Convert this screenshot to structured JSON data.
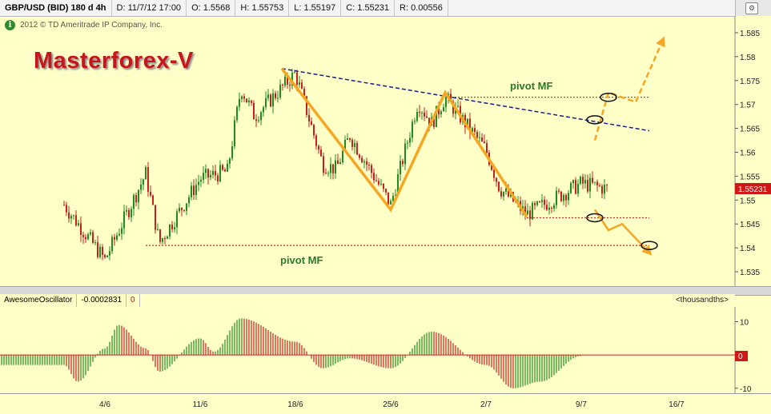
{
  "header": {
    "symbol": "GBP/USD (BID) 180 d 4h",
    "date": "D: 11/7/12 17:00",
    "open": "O: 1.5568",
    "high": "H: 1.55753",
    "low": "L: 1.55197",
    "close": "C: 1.55231",
    "range": "R: 0.00556"
  },
  "copyright": "2012 © TD Ameritrade IP Company, Inc.",
  "brand": "Masterforex-V",
  "price_badge": "1.55231",
  "annotations": {
    "pivot_upper": "pivot MF",
    "pivot_lower": "pivot MF"
  },
  "indicator": {
    "name": "AwesomeOscillator",
    "value": "-0.0002831",
    "zero": "0",
    "unit": "<thousandths>"
  },
  "osc_badge": "0",
  "colors": {
    "background": "#ffffc8",
    "up": "#1e8c1e",
    "down": "#c81e1e",
    "trend": "#f5a623",
    "trendline": "#1a1a8c",
    "pivot": "#cc2222",
    "brand": "#c8151b"
  },
  "chart_data": [
    {
      "type": "candlestick",
      "title": "GBP/USD (BID) 180 d 4h",
      "ylim": [
        1.5335,
        1.587
      ],
      "y_ticks": [
        "1.535",
        "1.54",
        "1.545",
        "1.55",
        "1.555",
        "1.56",
        "1.565",
        "1.57",
        "1.575",
        "1.58",
        "1.585"
      ],
      "x_tick_labels": [
        "4/6",
        "11/6",
        "18/6",
        "25/6",
        "2/7",
        "9/7",
        "16/7"
      ],
      "swing_points": [
        {
          "x": "1/6",
          "y": 1.549
        },
        {
          "x": "4/6",
          "y": 1.5375
        },
        {
          "x": "7/6",
          "y": 1.5555
        },
        {
          "x": "8/6",
          "y": 1.541
        },
        {
          "x": "11/6",
          "y": 1.5545
        },
        {
          "x": "13/6",
          "y": 1.556
        },
        {
          "x": "14/6",
          "y": 1.5735
        },
        {
          "x": "15/6",
          "y": 1.5675
        },
        {
          "x": "18/6",
          "y": 1.5765
        },
        {
          "x": "20/6",
          "y": 1.5575
        },
        {
          "x": "21/6",
          "y": 1.5565
        },
        {
          "x": "22/6",
          "y": 1.5635
        },
        {
          "x": "25/6",
          "y": 1.549
        },
        {
          "x": "27/6",
          "y": 1.5705
        },
        {
          "x": "28/6",
          "y": 1.566
        },
        {
          "x": "29/6",
          "y": 1.5715
        },
        {
          "x": "2/7",
          "y": 1.5605
        },
        {
          "x": "3/7",
          "y": 1.5525
        },
        {
          "x": "5/7",
          "y": 1.547
        },
        {
          "x": "9/7",
          "y": 1.5535
        },
        {
          "x": "11/7",
          "y": 1.55231
        }
      ],
      "trend_path": [
        {
          "x": "17/6",
          "y": 1.5775
        },
        {
          "x": "25/6",
          "y": 1.548
        },
        {
          "x": "29/6",
          "y": 1.5725
        },
        {
          "x": "5/7",
          "y": 1.5465
        }
      ],
      "trendline": [
        {
          "x": "17/6",
          "y": 1.5775
        },
        {
          "x": "14/7",
          "y": 1.5645
        }
      ],
      "pivots": [
        {
          "label": "pivot MF",
          "y": 1.5715,
          "from": "29/6",
          "to": "14/7"
        },
        {
          "label": "",
          "y": 1.5463,
          "from": "5/7",
          "to": "14/7"
        },
        {
          "label": "pivot MF",
          "y": 1.5405,
          "from": "7/6",
          "to": "14/7"
        }
      ],
      "scenario_up": [
        {
          "x": "10/7",
          "y": 1.5625
        },
        {
          "x": "11/7",
          "y": 1.5725
        },
        {
          "x": "13/7",
          "y": 1.5705
        },
        {
          "x": "15/7",
          "y": 1.5835
        }
      ],
      "scenario_down": [
        {
          "x": "10/7",
          "y": 1.548
        },
        {
          "x": "11/7",
          "y": 1.5437
        },
        {
          "x": "12/7",
          "y": 1.545
        },
        {
          "x": "14/7",
          "y": 1.539
        }
      ],
      "last_close": 1.55231
    },
    {
      "type": "bar",
      "title": "AwesomeOscillator",
      "ylabel": "<thousandths>",
      "ylim": [
        -11,
        13
      ],
      "y_ticks": [
        "10",
        "0",
        "-10"
      ],
      "waves": [
        {
          "x": "1/6",
          "value": -3
        },
        {
          "x": "2/6",
          "value": -8
        },
        {
          "x": "4/6",
          "value": 2
        },
        {
          "x": "5/6",
          "value": 9
        },
        {
          "x": "7/6",
          "value": 2
        },
        {
          "x": "8/6",
          "value": -5
        },
        {
          "x": "11/6",
          "value": 5
        },
        {
          "x": "12/6",
          "value": 1
        },
        {
          "x": "14/6",
          "value": 11
        },
        {
          "x": "18/6",
          "value": 4
        },
        {
          "x": "20/6",
          "value": -4
        },
        {
          "x": "22/6",
          "value": -1
        },
        {
          "x": "25/6",
          "value": -4
        },
        {
          "x": "28/6",
          "value": 7
        },
        {
          "x": "2/7",
          "value": -3
        },
        {
          "x": "4/7",
          "value": -10
        },
        {
          "x": "6/7",
          "value": -8
        },
        {
          "x": "9/7",
          "value": -0.3
        }
      ]
    }
  ]
}
